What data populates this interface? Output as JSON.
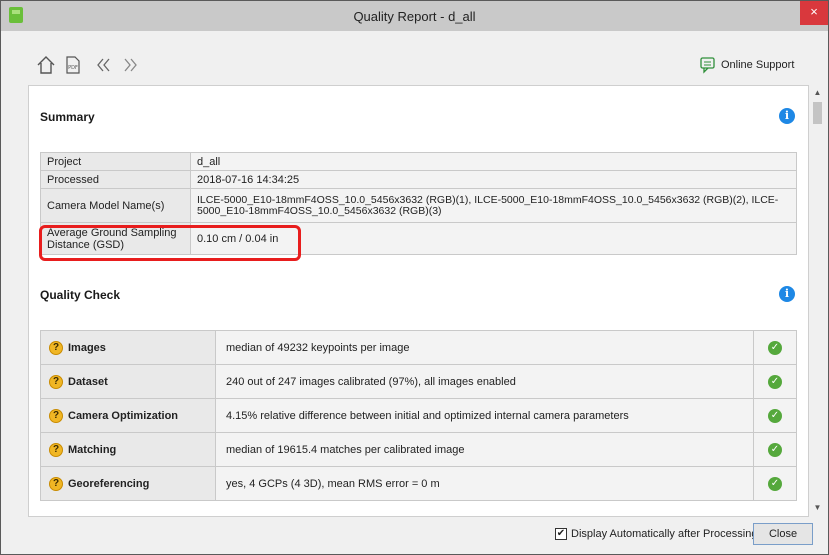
{
  "window": {
    "title": "Quality Report - d_all",
    "close_glyph": "×"
  },
  "toolbar": {
    "icons": [
      "home-icon",
      "pdf-icon",
      "back-icon",
      "forward-icon"
    ],
    "pdf_label": "PDF",
    "online_support": "Online Support"
  },
  "summary": {
    "title": "Summary",
    "info_glyph": "i",
    "rows": [
      {
        "label": "Project",
        "value": "d_all"
      },
      {
        "label": "Processed",
        "value": "2018-07-16 14:34:25"
      },
      {
        "label": "Camera Model Name(s)",
        "value": "ILCE-5000_E10-18mmF4OSS_10.0_5456x3632 (RGB)(1), ILCE-5000_E10-18mmF4OSS_10.0_5456x3632 (RGB)(2), ILCE-5000_E10-18mmF4OSS_10.0_5456x3632 (RGB)(3)"
      },
      {
        "label": "Average Ground Sampling Distance (GSD)",
        "value": "0.10 cm / 0.04 in"
      }
    ]
  },
  "quality_check": {
    "title": "Quality Check",
    "info_glyph": "i",
    "rows": [
      {
        "label": "Images",
        "value": "median of 49232 keypoints per image"
      },
      {
        "label": "Dataset",
        "value": "240 out of 247 images calibrated (97%), all images enabled"
      },
      {
        "label": "Camera Optimization",
        "value": "4.15% relative difference between initial and optimized internal camera parameters"
      },
      {
        "label": "Matching",
        "value": "median of 19615.4 matches per calibrated image"
      },
      {
        "label": "Georeferencing",
        "value": "yes, 4 GCPs (4 3D), mean RMS error = 0 m"
      }
    ],
    "warn_glyph": "?",
    "ok_glyph": "✓"
  },
  "footer": {
    "checkbox_label": "Display Automatically after Processing",
    "checkbox_checked": true,
    "checkbox_glyph": "✔",
    "close_label": "Close"
  },
  "colors": {
    "titlebar": "#c9c9c9",
    "close": "#d9383d",
    "info": "#1e88e5",
    "warn": "#f0b624",
    "ok": "#55a83c",
    "highlight": "#e81d1d"
  }
}
